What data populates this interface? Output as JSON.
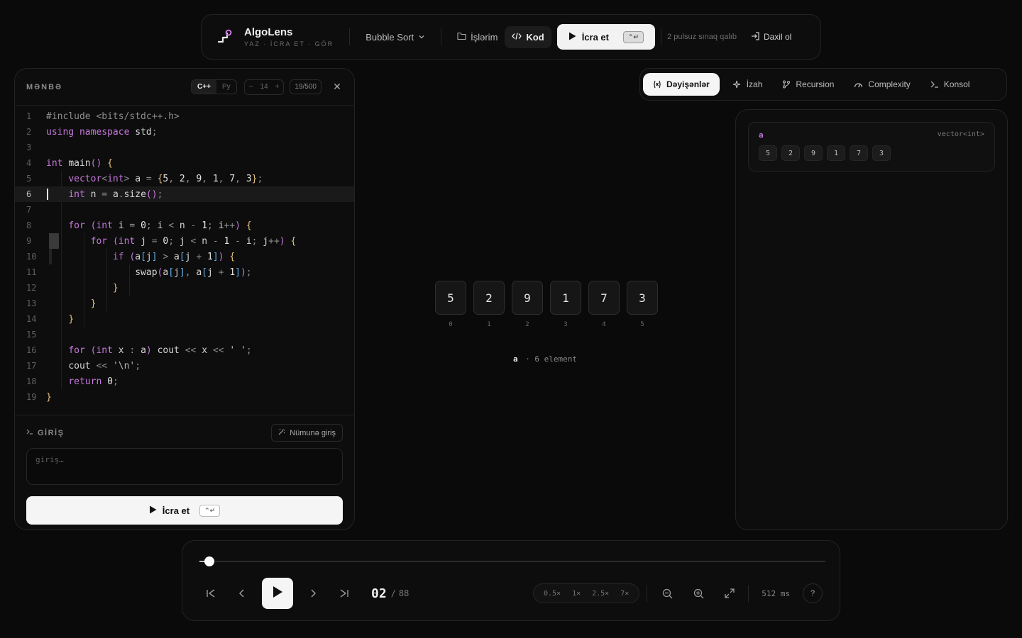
{
  "topbar": {
    "brand_name": "AlgoLens",
    "brand_tagline": "YAZ · İCRA ET · GÖR",
    "algorithm_select": "Bubble Sort",
    "my_works": "İşlərim",
    "code_tab": "Kod",
    "run_label": "İcra et",
    "run_shortcut": "⌃↵",
    "trial_text": "2 pulsuz sınaq qalıb",
    "login_label": "Daxil ol"
  },
  "editor": {
    "title": "MƏNBƏ",
    "lang_cpp": "C++",
    "lang_py": "Py",
    "font_size": "14",
    "char_count": "19/500",
    "current_line": 6,
    "lines": [
      "#include <bits/stdc++.h>",
      "using namespace std;",
      "",
      "int main() {",
      "    vector<int> a = {5, 2, 9, 1, 7, 3};",
      "    int n = a.size();",
      "",
      "    for (int i = 0; i < n - 1; i++) {",
      "        for (int j = 0; j < n - 1 - i; j++) {",
      "            if (a[j] > a[j + 1]) {",
      "                swap(a[j], a[j + 1]);",
      "            }",
      "        }",
      "    }",
      "",
      "    for (int x : a) cout << x << ' ';",
      "    cout << '\\n';",
      "    return 0;",
      "}"
    ]
  },
  "input": {
    "title": "GİRİŞ",
    "sample_button": "Nümunə giriş",
    "placeholder": "giriş…",
    "run_label": "İcra et",
    "run_shortcut": "⌃↵"
  },
  "visual": {
    "array_name": "a",
    "caption_rest": "· 6 element",
    "cells": [
      {
        "value": "5",
        "index": "0"
      },
      {
        "value": "2",
        "index": "1"
      },
      {
        "value": "9",
        "index": "2"
      },
      {
        "value": "1",
        "index": "3"
      },
      {
        "value": "7",
        "index": "4"
      },
      {
        "value": "3",
        "index": "5"
      }
    ]
  },
  "tabs": [
    "Dəyişənlər",
    "İzah",
    "Recursion",
    "Complexity",
    "Konsol"
  ],
  "variables": [
    {
      "name": "a",
      "type": "vector<int>",
      "values": [
        "5",
        "2",
        "9",
        "1",
        "7",
        "3"
      ]
    }
  ],
  "player": {
    "progress": 0.01,
    "step": "02",
    "total": "88",
    "speeds": [
      "0.5×",
      "1×",
      "2.5×",
      "7×"
    ],
    "delay": "512 ms",
    "help": "?"
  }
}
